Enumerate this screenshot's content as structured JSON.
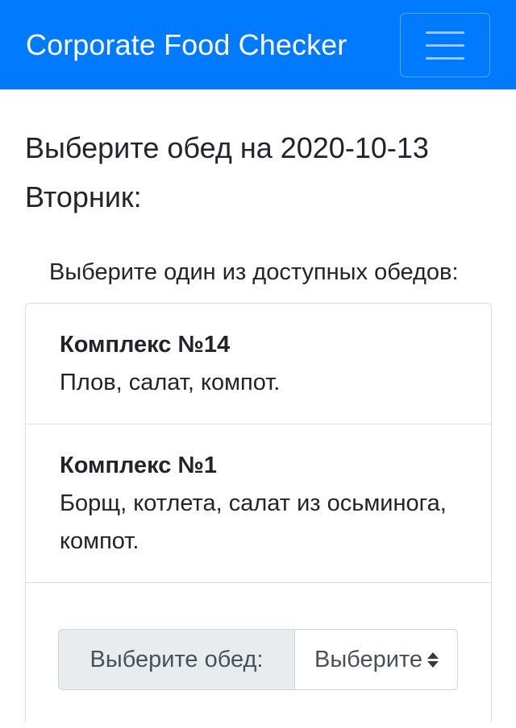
{
  "navbar": {
    "brand": "Corporate Food Checker",
    "toggler_icon": "hamburger-icon",
    "color": "#007bff"
  },
  "page": {
    "heading": "Выберите обед на 2020-10-13 Вторник:",
    "prompt": "Выберите один из доступных обедов:"
  },
  "lunches": [
    {
      "title": "Комплекс №14",
      "description": "Плов, салат, компот."
    },
    {
      "title": "Комплекс №1",
      "description": "Борщ, котлета, салат из осьминога, компот."
    }
  ],
  "form": {
    "label": "Выберите обед:",
    "select_value": "Выберите",
    "select_icon": "sort-arrows-icon"
  }
}
